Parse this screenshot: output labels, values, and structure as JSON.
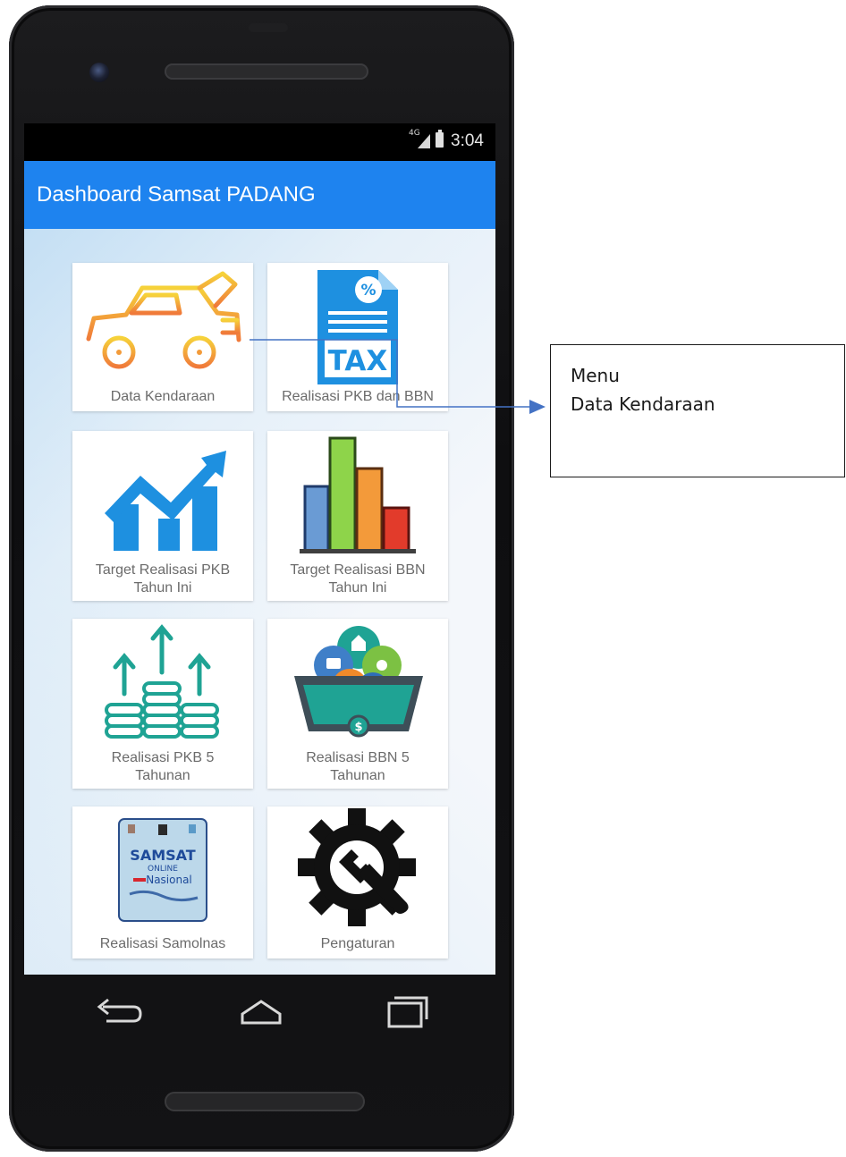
{
  "status_bar": {
    "network": "4G",
    "time": "3:04"
  },
  "app_bar": {
    "title": "Dashboard Samsat PADANG"
  },
  "menu": {
    "items": [
      {
        "label": "Data Kendaraan",
        "icon": "car-icon"
      },
      {
        "label": "Realisasi PKB dan BBN",
        "icon": "tax-document-icon"
      },
      {
        "label": "Target Realisasi PKB Tahun Ini",
        "label_line1": "Target Realisasi PKB",
        "label_line2": "Tahun Ini",
        "icon": "growth-chart-icon"
      },
      {
        "label": "Target Realisasi BBN Tahun Ini",
        "label_line1": "Target Realisasi BBN",
        "label_line2": "Tahun Ini",
        "icon": "bar-chart-icon"
      },
      {
        "label": "Realisasi PKB 5 Tahunan",
        "label_line1": "Realisasi PKB 5",
        "label_line2": "Tahunan",
        "icon": "coin-stacks-icon"
      },
      {
        "label": "Realisasi BBN 5 Tahunan",
        "label_line1": "Realisasi BBN 5",
        "label_line2": "Tahunan",
        "icon": "shopping-basket-icon"
      },
      {
        "label": "Realisasi Samolnas",
        "icon": "samsat-online-logo-icon",
        "logo_text": [
          "SAMSAT",
          "ONLINE",
          "Nasional"
        ]
      },
      {
        "label": "Pengaturan",
        "icon": "gear-wrench-icon"
      }
    ]
  },
  "nav_bar": {
    "icons": [
      "back-icon",
      "home-icon",
      "recents-icon"
    ]
  },
  "callout": {
    "line1": "Menu",
    "line2": "Data Kendaraan"
  },
  "colors": {
    "app_bar": "#1E83EF",
    "connector": "#4472C4",
    "label_text": "#6B6B6B"
  }
}
